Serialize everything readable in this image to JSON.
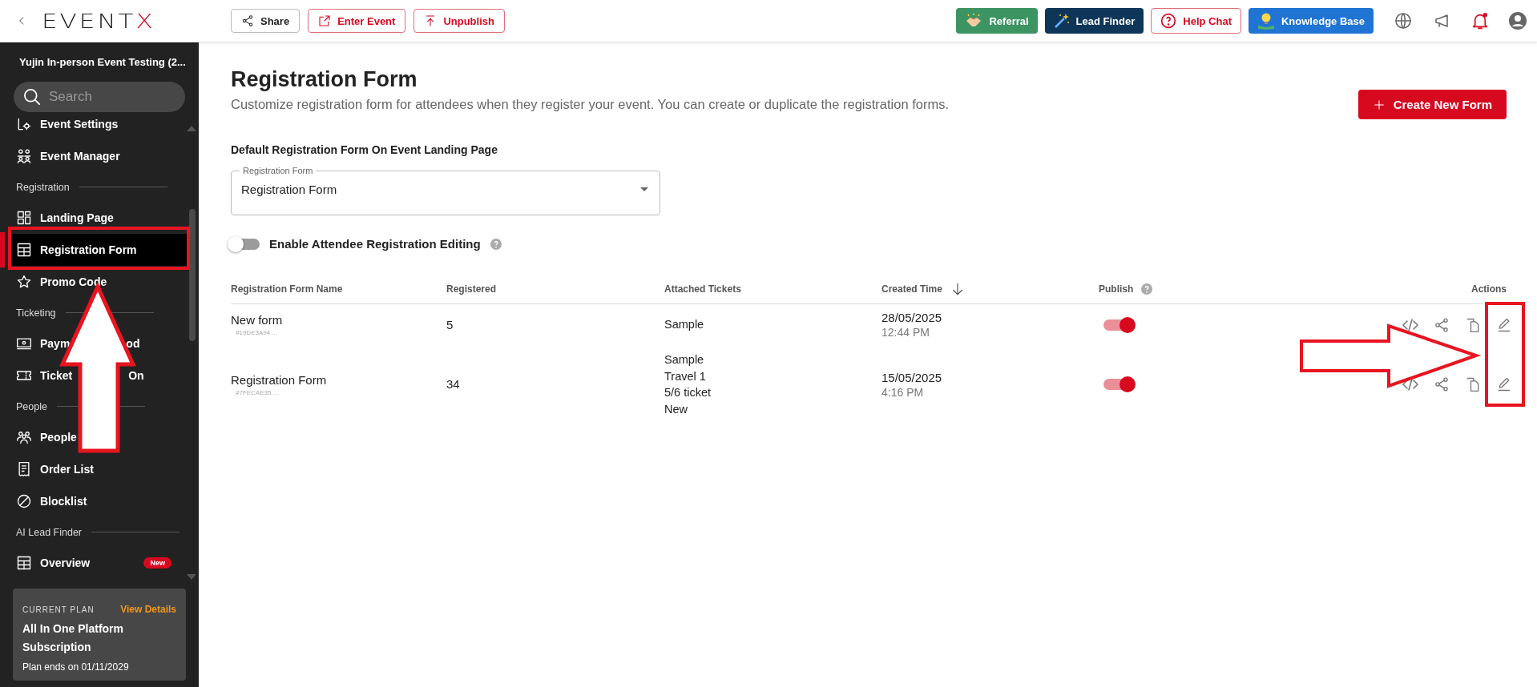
{
  "topbar": {
    "logo": {
      "main": "EVENT",
      "accent": "X"
    },
    "event_actions": [
      {
        "label": "Share",
        "kind": "neutral"
      },
      {
        "label": "Enter Event",
        "kind": "danger"
      },
      {
        "label": "Unpublish",
        "kind": "danger"
      }
    ],
    "tools": [
      {
        "label": "Referral",
        "kind": "referral"
      },
      {
        "label": "Lead Finder",
        "kind": "lead"
      },
      {
        "label": "Help Chat",
        "kind": "help"
      },
      {
        "label": "Knowledge Base",
        "kind": "knowledge"
      }
    ],
    "notifications": {
      "unread": true
    }
  },
  "sidebar": {
    "event_title": "Yujin In-person Event Testing (2...",
    "search": {
      "placeholder": "Search"
    },
    "nav": [
      {
        "kind": "item",
        "label": "Event Settings",
        "selected": false
      },
      {
        "kind": "item",
        "label": "Event Manager",
        "selected": false
      },
      {
        "kind": "header",
        "label": "Registration"
      },
      {
        "kind": "item",
        "label": "Landing Page",
        "selected": false
      },
      {
        "kind": "item",
        "label": "Registration Form",
        "selected": true
      },
      {
        "kind": "item",
        "label": "Promo Code",
        "selected": false
      },
      {
        "kind": "header",
        "label": "Ticketing"
      },
      {
        "kind": "item",
        "label": "Paym",
        "label_tail": "od",
        "selected": false
      },
      {
        "kind": "item",
        "label": "Ticket",
        "label_tail": "On",
        "selected": false
      },
      {
        "kind": "header",
        "label": "People"
      },
      {
        "kind": "item",
        "label": "People",
        "selected": false
      },
      {
        "kind": "item",
        "label": "Order List",
        "selected": false
      },
      {
        "kind": "item",
        "label": "Blocklist",
        "selected": false
      },
      {
        "kind": "header",
        "label": "AI Lead Finder"
      },
      {
        "kind": "item",
        "label": "Overview",
        "badge": "New",
        "selected": false
      }
    ],
    "plan": {
      "caption": "CURRENT PLAN",
      "link": "View Details",
      "name": "All In One Platform Subscription",
      "ends": "Plan ends on 01/11/2029"
    }
  },
  "page": {
    "title": "Registration Form",
    "subtitle": "Customize registration form for attendees when they register your event. You can create or duplicate the registration forms.",
    "create_button": "Create New Form",
    "default_heading": "Default Registration Form On Event Landing Page",
    "default_select": {
      "label": "Registration Form",
      "value": "Registration Form"
    },
    "editing_toggle": {
      "label": "Enable Attendee Registration Editing",
      "on": false
    },
    "table": {
      "columns": [
        "Registration Form Name",
        "Registered",
        "Attached Tickets",
        "Created Time",
        "Publish",
        "Actions"
      ],
      "rows": [
        {
          "name": "New form",
          "id": "#19DE3A94 ...",
          "registered": "5",
          "tickets": [
            "Sample"
          ],
          "date": "28/05/2025",
          "time": "12:44 PM",
          "published": true
        },
        {
          "name": "Registration Form",
          "id": "#7FECAE35 ...",
          "registered": "34",
          "tickets": [
            "Sample",
            "Travel 1",
            "5/6 ticket",
            "New"
          ],
          "date": "15/05/2025",
          "time": "4:16 PM",
          "published": true
        }
      ]
    }
  }
}
